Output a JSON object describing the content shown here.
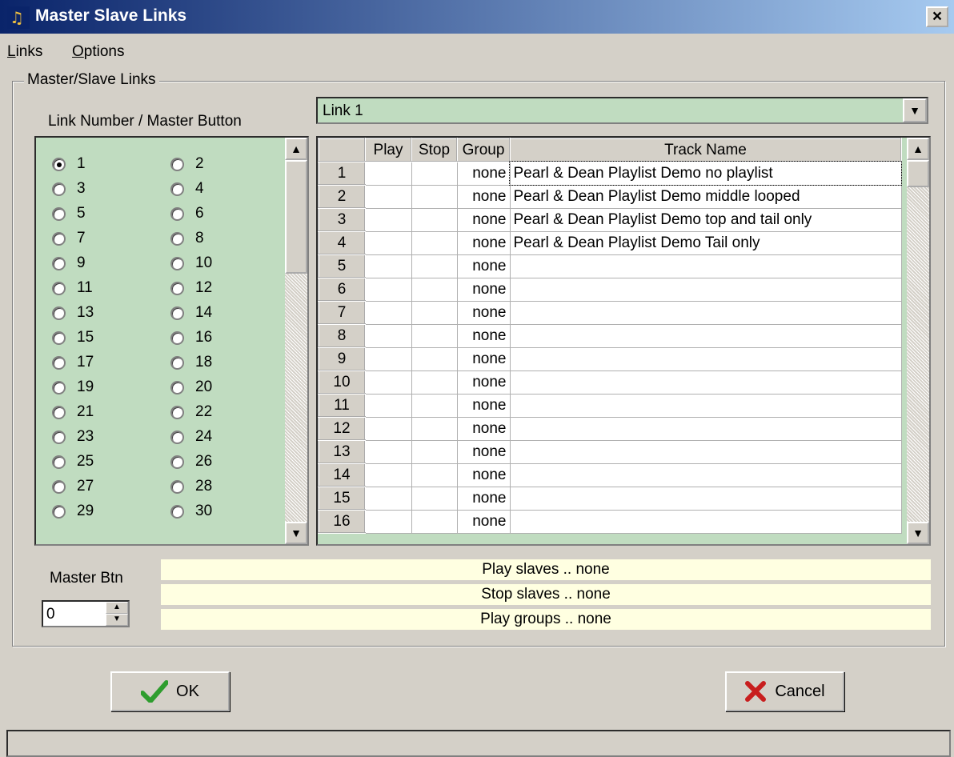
{
  "window": {
    "title": "Master Slave Links",
    "close_label": "×"
  },
  "menu": [
    {
      "first": "L",
      "rest": "inks"
    },
    {
      "first": "O",
      "rest": "ptions"
    }
  ],
  "group": {
    "label": "Master/Slave Links"
  },
  "left": {
    "label": "Link Number / Master Button",
    "selected": 1,
    "radios": [
      "1",
      "2",
      "3",
      "4",
      "5",
      "6",
      "7",
      "8",
      "9",
      "10",
      "11",
      "12",
      "13",
      "14",
      "15",
      "16",
      "17",
      "18",
      "19",
      "20",
      "21",
      "22",
      "23",
      "24",
      "25",
      "26",
      "27",
      "28",
      "29",
      "30"
    ]
  },
  "combo": {
    "value": "Link 1"
  },
  "table": {
    "columns": [
      "",
      "Play",
      "Stop",
      "Group",
      "Track Name"
    ],
    "rows": [
      {
        "n": "1",
        "play": "",
        "stop": "",
        "group": "none",
        "track": "Pearl & Dean Playlist Demo no playlist"
      },
      {
        "n": "2",
        "play": "",
        "stop": "",
        "group": "none",
        "track": "Pearl & Dean Playlist Demo middle looped"
      },
      {
        "n": "3",
        "play": "",
        "stop": "",
        "group": "none",
        "track": "Pearl & Dean Playlist Demo top and tail only"
      },
      {
        "n": "4",
        "play": "",
        "stop": "",
        "group": "none",
        "track": "Pearl & Dean Playlist Demo Tail only"
      },
      {
        "n": "5",
        "play": "",
        "stop": "",
        "group": "none",
        "track": ""
      },
      {
        "n": "6",
        "play": "",
        "stop": "",
        "group": "none",
        "track": ""
      },
      {
        "n": "7",
        "play": "",
        "stop": "",
        "group": "none",
        "track": ""
      },
      {
        "n": "8",
        "play": "",
        "stop": "",
        "group": "none",
        "track": ""
      },
      {
        "n": "9",
        "play": "",
        "stop": "",
        "group": "none",
        "track": ""
      },
      {
        "n": "10",
        "play": "",
        "stop": "",
        "group": "none",
        "track": ""
      },
      {
        "n": "11",
        "play": "",
        "stop": "",
        "group": "none",
        "track": ""
      },
      {
        "n": "12",
        "play": "",
        "stop": "",
        "group": "none",
        "track": ""
      },
      {
        "n": "13",
        "play": "",
        "stop": "",
        "group": "none",
        "track": ""
      },
      {
        "n": "14",
        "play": "",
        "stop": "",
        "group": "none",
        "track": ""
      },
      {
        "n": "15",
        "play": "",
        "stop": "",
        "group": "none",
        "track": ""
      },
      {
        "n": "16",
        "play": "",
        "stop": "",
        "group": "none",
        "track": ""
      }
    ]
  },
  "master_btn": {
    "label": "Master Btn",
    "value": "0"
  },
  "info": {
    "play_slaves": "Play slaves .. none",
    "stop_slaves": "Stop slaves .. none",
    "play_groups": "Play groups .. none"
  },
  "buttons": {
    "ok": "OK",
    "cancel": "Cancel"
  },
  "colors": {
    "panel": "#c0dcc0",
    "info_bg": "#ffffe1",
    "title_start": "#0a246a",
    "title_end": "#a6caf0",
    "ok_check": "#2e9d2e",
    "cancel_x": "#c81e1e"
  }
}
